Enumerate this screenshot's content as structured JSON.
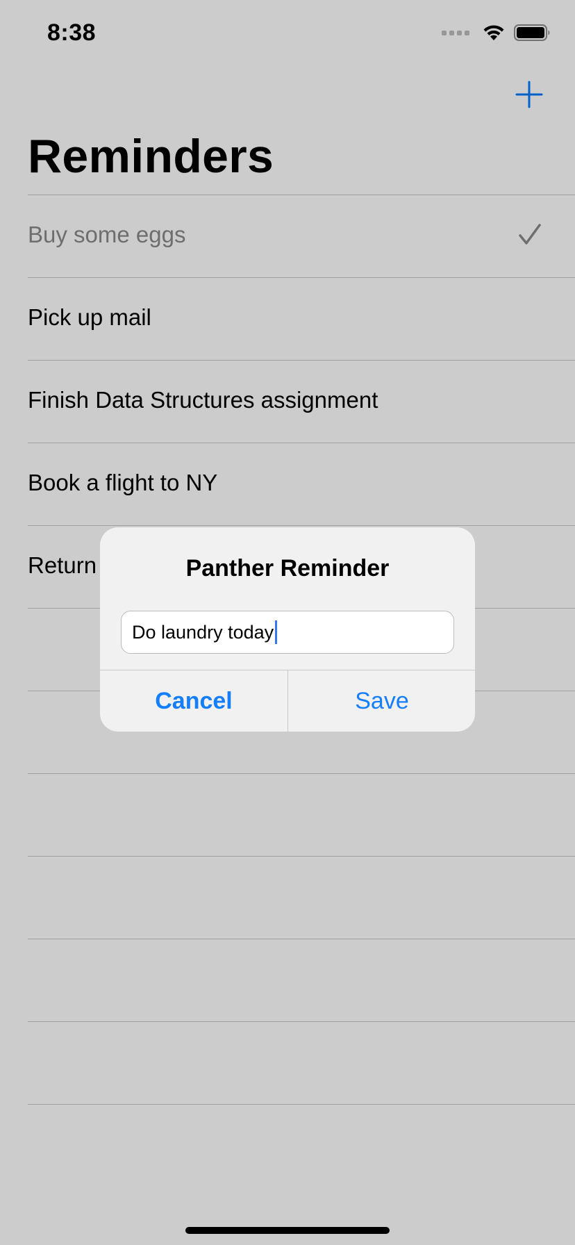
{
  "status_bar": {
    "time": "8:38"
  },
  "nav": {
    "title": "Reminders",
    "add_icon": "plus-icon"
  },
  "reminders": [
    {
      "label": "Buy some eggs",
      "done": true
    },
    {
      "label": "Pick up mail",
      "done": false
    },
    {
      "label": "Finish Data Structures assignment",
      "done": false
    },
    {
      "label": "Book a flight to NY",
      "done": false
    },
    {
      "label": "Return",
      "done": false
    },
    {
      "label": "",
      "done": false
    },
    {
      "label": "",
      "done": false
    },
    {
      "label": "",
      "done": false
    },
    {
      "label": "",
      "done": false
    },
    {
      "label": "",
      "done": false
    },
    {
      "label": "",
      "done": false
    },
    {
      "label": "",
      "done": false
    }
  ],
  "alert": {
    "title": "Panther Reminder",
    "field_value": "Do laundry today",
    "cancel_label": "Cancel",
    "save_label": "Save"
  },
  "colors": {
    "accent": "#157efb",
    "caret": "#3478f6",
    "separator": "#c8c7cc",
    "done_text": "#8a8a8e"
  }
}
